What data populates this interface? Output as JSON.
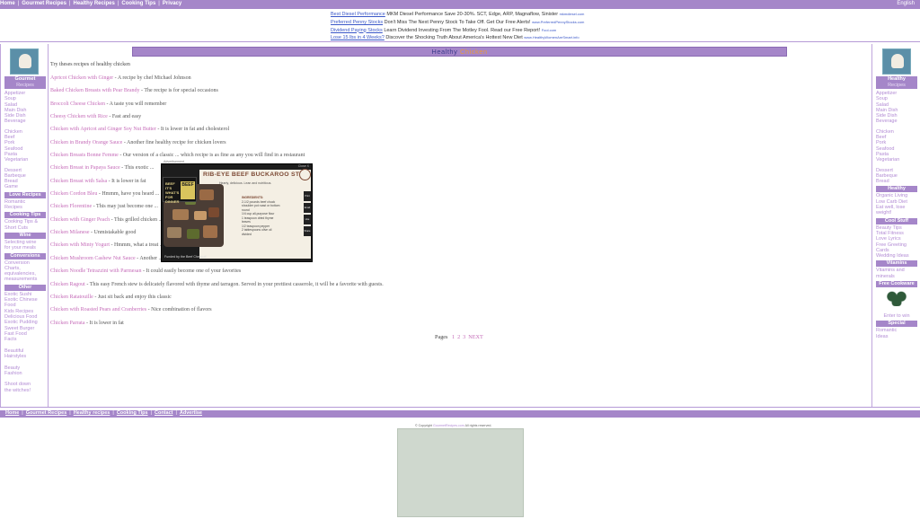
{
  "top_nav": {
    "links": [
      "Home",
      "Gourmet Recipes",
      "Healthy Recipes",
      "Cooking Tips",
      "Privacy"
    ],
    "right": "English"
  },
  "ads": [
    {
      "title": "Best Diesel Performance",
      "desc": "MKM Diesel Performance Save 20-30%. SCT, Edge, ARP, Magnaflow, Sinister",
      "url": "mkmdiesel.com"
    },
    {
      "title": "Preferred Penny Stocks",
      "desc": "Don't Miss The Next Penny Stock To Take Off. Get Our Free Alerts!",
      "url": "www.PreferredPennyStocks.com"
    },
    {
      "title": "Dividend Paying Stocks",
      "desc": "Learn Dividend Investing From The Motley Fool. Read our Free Report!",
      "url": "Fool.com"
    },
    {
      "title": "Lose 15 lbs in 4 Weeks?",
      "desc": "Discover the Shocking Truth About America's Hottest New Diet",
      "url": "www.HealthyWomenAreSmart.info"
    }
  ],
  "left_sidebar": {
    "header_title": "Gourmet",
    "header_sub": "Recipes",
    "groups": [
      {
        "items": [
          "Appetizer",
          "Soup",
          "Salad",
          "Main Dish",
          "Side Dish",
          "Beverage"
        ]
      },
      {
        "items": [
          "Chicken",
          "Beef",
          "Pork",
          "Seafood",
          "Pasta",
          "Vegetarian"
        ]
      },
      {
        "items": [
          "Dessert",
          "Barbeque",
          "Bread",
          "Game"
        ]
      },
      {
        "header": "Love Recipes",
        "items": [
          "Romantic",
          "Recipes"
        ]
      },
      {
        "header": "Cooking Tips",
        "items": [
          "Cooking Tips &",
          "Short Cuts"
        ]
      },
      {
        "header": "Wine",
        "items": [
          "Selecting wine",
          "for your meals"
        ]
      },
      {
        "header": "Conversions",
        "items": [
          "Conversion",
          "Charts,",
          "equivalencies,",
          "measurements"
        ]
      },
      {
        "header": "Other",
        "items": [
          "Exotic Sushi",
          "Exotic Chinese",
          "Food",
          "Kids Recipes",
          "Delicious Food",
          "Exotic Pudding",
          "Sweet Burger",
          "Fast Food",
          "Facts",
          "",
          "Beautiful",
          "Hairstyles",
          "",
          "Beauty",
          "Fashion",
          "",
          "Shoot down",
          "the witches!"
        ]
      }
    ]
  },
  "right_sidebar": {
    "header_title": "Healthy",
    "header_sub": "Recipes",
    "groups": [
      {
        "items": [
          "Appetizer",
          "Soup",
          "Salad",
          "Main Dish",
          "Side Dish",
          "Beverage"
        ]
      },
      {
        "items": [
          "Chicken",
          "Beef",
          "Pork",
          "Seafood",
          "Pasta",
          "Vegetarian"
        ]
      },
      {
        "items": [
          "Dessert",
          "Barbeque",
          "Bread"
        ]
      },
      {
        "header": "Healthy",
        "items": [
          "Organic Living",
          "Low Carb Diet",
          "Eat well, lose",
          "weight!"
        ]
      },
      {
        "header": "Cool Stuff",
        "items": [
          "Beauty Tips",
          "Total Fitness",
          "Love Lyrics",
          "Free Greeting",
          "Cards",
          "Wedding Ideas"
        ]
      },
      {
        "header": "Vitamins",
        "items": [
          "Vitamins and",
          "minerals"
        ]
      },
      {
        "header": "Free Cookware",
        "items": []
      },
      {
        "items": [
          "Enter to win"
        ]
      },
      {
        "header": "Special",
        "items": [
          "Romantic",
          "Ideas"
        ]
      }
    ]
  },
  "main": {
    "title_part1": "Healthy",
    "title_part2": "Chicken",
    "intro": "Try theses recipes of healthy chicken",
    "recipes": [
      {
        "name": "Apricot Chicken with Ginger",
        "desc": " - A recipe by chef Michael Johnson"
      },
      {
        "name": "Baked Chicken Breasts with Pear Brandy",
        "desc": " - The recipe is for special occasions"
      },
      {
        "name": "Broccoli Cheese Chicken",
        "desc": " - A taste you will remember"
      },
      {
        "name": "Cheesy Chicken with Rice",
        "desc": " - Fast and easy"
      },
      {
        "name": "Chicken with Apricot and Ginger Soy Nut Butter",
        "desc": " - It is lower in fat and cholesterol"
      },
      {
        "name": "Chicken in Brandy Orange Sauce",
        "desc": " - Another fine healthy recipe for chicken lovers"
      },
      {
        "name": "Chicken Breasts Bonne Femme",
        "desc": " - Our version of a classic ... which recipe is as fine as any you will find in a restaurant"
      },
      {
        "name": "Chicken Breast in Papaya Sauce",
        "desc": " - This exotic ..."
      },
      {
        "name": "Chicken Breast with Salsa",
        "desc": " - It is lower in fat"
      },
      {
        "name": "Chicken Cordon Bleu",
        "desc": " - Hmmm, have you heard ..."
      },
      {
        "name": "Chicken Florentine",
        "desc": " - This may just become one ..."
      },
      {
        "name": "Chicken with Ginger Peach",
        "desc": " - This grilled chicken ..."
      },
      {
        "name": "Chicken Milanese",
        "desc": " - Unmistakable good"
      },
      {
        "name": "Chicken with Minty Yogurt",
        "desc": " - Hmmm, what a treat ..."
      },
      {
        "name": "Chicken Mushroom Cashew Nut Sauce",
        "desc": " - Another ..."
      },
      {
        "name": "Chicken Noodle Tetrazzini with Parmesan",
        "desc": " - It could easily become one of your favorites"
      },
      {
        "name": "Chicken Ragout",
        "desc": " - This easy French stew is delicately flavored with thyme and tarragon. Served in your prettiest casserole, it will be a favorite with guests."
      },
      {
        "name": "Chicken Ratatouille",
        "desc": " - Just sit back and enjoy this classic"
      },
      {
        "name": "Chicken with Roasted Pears and Cranberries",
        "desc": " - Nice combination of flavors"
      },
      {
        "name": "Chicken Parrata",
        "desc": " - It is lower in fat"
      }
    ],
    "pages_label": "Pages",
    "pages": [
      "1",
      "2",
      "3",
      "NEXT"
    ]
  },
  "popup_ad": {
    "caption": "Advertisement",
    "close": "Close X",
    "badge_text": "BEEF IT'S WHAT'S FOR DINNER",
    "badge_label": "BEEF",
    "title": "RIB-EYE BEEF BUCKAROO STEW",
    "subtitle": "Hearty, delicious. Lean and nutritious.",
    "ingredients_header": "INGREDIENTS:",
    "ingredients": [
      "2-1/2 pounds beef chuck shoulder pot roast or bottom round",
      "1/4 cup all-purpose flour",
      "1 teaspoon dried thyme leaves",
      "1/2 teaspoon pepper",
      "2 tablespoons olive oil",
      "divided"
    ],
    "side_buttons": [
      "Print",
      "Email",
      "Like",
      "Share"
    ],
    "funded": "Funded by the Beef Checkoff.",
    "buttons": [
      "GET RECIPE",
      "MORE RECIPES",
      "NUTRITION"
    ]
  },
  "bottom_nav": {
    "links": [
      "Home",
      "Gourmet Recipes",
      "Healthy recipes",
      "Cooking Tips",
      "Contact",
      "Advertise"
    ]
  },
  "copyright": {
    "prefix": "© Copyright",
    "site": "GourmetRecipes.com",
    "suffix": "All rights reserved."
  },
  "colors": {
    "accent": "#a586c9",
    "link": "#c56bb8",
    "sidebar_link": "#b28bd4",
    "title_text": "#3b3b8a",
    "title_highlight": "#e79b3b"
  }
}
